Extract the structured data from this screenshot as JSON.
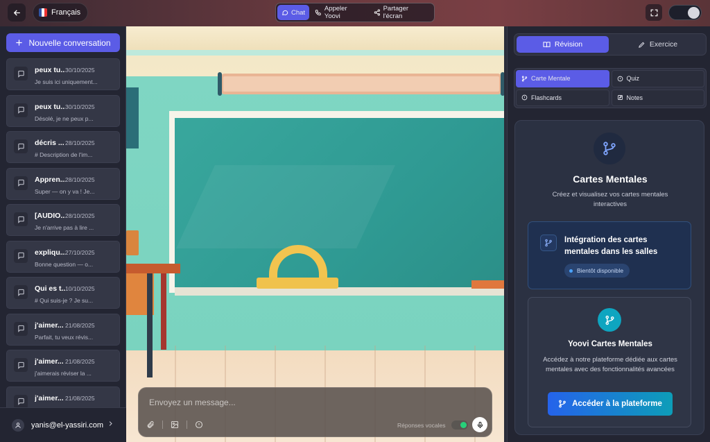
{
  "header": {
    "language": "Français",
    "modes": [
      {
        "label": "Chat",
        "icon": "chat-bubble-icon",
        "active": true
      },
      {
        "label": "Appeler Yoovi",
        "icon": "phone-icon",
        "active": false
      },
      {
        "label": "Partager l'écran",
        "icon": "share-icon",
        "active": false
      }
    ]
  },
  "sidebar": {
    "new_conversation": "Nouvelle conversation",
    "conversations": [
      {
        "title": "peux tu...",
        "date": "30/10/2025",
        "snippet": "Je suis ici uniquement..."
      },
      {
        "title": "peux tu...",
        "date": "30/10/2025",
        "snippet": "Désolé, je ne peux p..."
      },
      {
        "title": "décris ...",
        "date": "28/10/2025",
        "snippet": "# Description de l'im..."
      },
      {
        "title": "Appren...",
        "date": "28/10/2025",
        "snippet": "Super — on y va ! Je..."
      },
      {
        "title": "[AUDIO...",
        "date": "28/10/2025",
        "snippet": "Je n'arrive pas à lire ..."
      },
      {
        "title": "expliqu...",
        "date": "27/10/2025",
        "snippet": "Bonne question — o..."
      },
      {
        "title": "Qui es t...",
        "date": "10/10/2025",
        "snippet": "# Qui suis-je ? Je su..."
      },
      {
        "title": "j'aimer...",
        "date": "21/08/2025",
        "snippet": "Parfait, tu veux révis..."
      },
      {
        "title": "j'aimer...",
        "date": "21/08/2025",
        "snippet": "j'aimerais réviser la ..."
      },
      {
        "title": "j'aimer...",
        "date": "21/08/2025",
        "snippet": ""
      }
    ],
    "user_email": "yanis@el-yassiri.com"
  },
  "composer": {
    "placeholder": "Envoyez un message...",
    "voice_replies_label": "Réponses vocales",
    "voice_replies_on": true
  },
  "right_panel": {
    "tabs": [
      {
        "label": "Révision",
        "icon": "book-icon",
        "active": true
      },
      {
        "label": "Exercice",
        "icon": "pencil-icon",
        "active": false
      }
    ],
    "subtabs": [
      {
        "label": "Carte Mentale",
        "icon": "branch-icon",
        "active": true
      },
      {
        "label": "Quiz",
        "icon": "info-icon",
        "active": false
      },
      {
        "label": "Flashcards",
        "icon": "info-icon",
        "active": false
      },
      {
        "label": "Notes",
        "icon": "edit-icon",
        "active": false
      }
    ],
    "card": {
      "title": "Cartes Mentales",
      "subtitle": "Créez et visualisez vos cartes mentales interactives",
      "feature_title": "Intégration des cartes mentales dans les salles",
      "feature_badge": "Bientôt disponible",
      "platform_title": "Yoovi Cartes Mentales",
      "platform_desc": "Accédez à notre plateforme dédiée aux cartes mentales avec des fonctionnalités avancées",
      "platform_cta": "Accéder à la plateforme"
    }
  },
  "colors": {
    "accent": "#5b5ce6",
    "panel_bg": "#232532",
    "cta_gradient_start": "#2563eb",
    "cta_gradient_end": "#0d9db8",
    "voice_on": "#27d17a"
  }
}
